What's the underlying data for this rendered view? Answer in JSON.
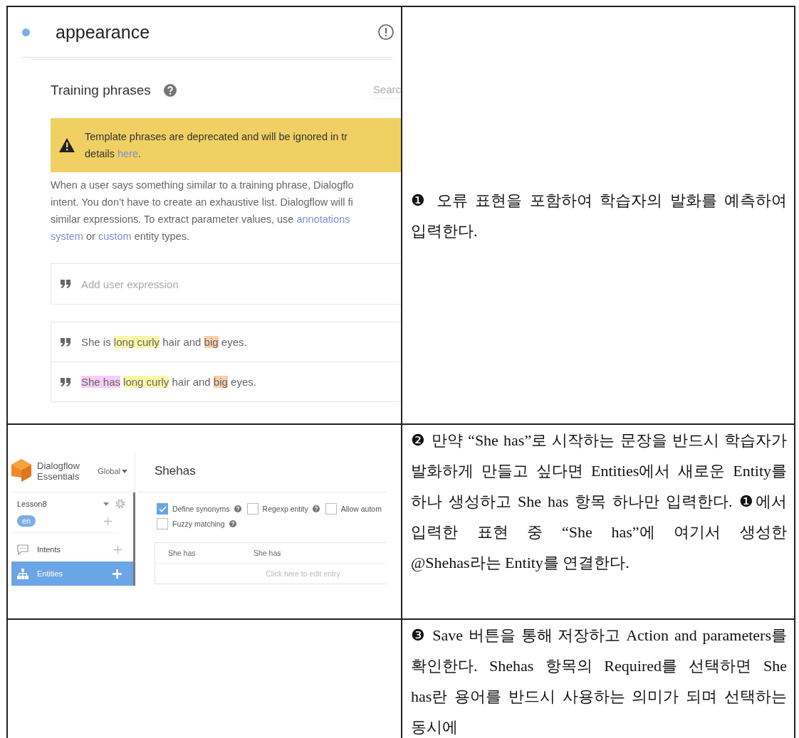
{
  "table": {
    "rows": [
      {
        "left": {
          "kind": "intent_training",
          "intent": {
            "title": "appearance"
          },
          "training": {
            "heading": "Training phrases",
            "search_placeholder": "Searc",
            "banner": [
              [
                {
                  "kind": "text",
                  "text": "Template phrases are deprecated and will be ignored in tr"
                }
              ],
              [
                {
                  "kind": "text",
                  "text": "details "
                },
                {
                  "kind": "link",
                  "text": "here"
                },
                {
                  "kind": "text",
                  "text": "."
                }
              ]
            ],
            "description": [
              [
                {
                  "kind": "text",
                  "text": "When a user says something similar to a training phrase, Dialogflo"
                }
              ],
              [
                {
                  "kind": "text",
                  "text": "intent. You don’t have to create an exhaustive list. Dialogflow will fi"
                }
              ],
              [
                {
                  "kind": "text",
                  "text": "similar expressions. To extract parameter values, use "
                },
                {
                  "kind": "link",
                  "text": "annotations"
                }
              ],
              [
                {
                  "kind": "link",
                  "text": "system"
                },
                {
                  "kind": "text",
                  "text": " or "
                },
                {
                  "kind": "link",
                  "text": "custom"
                },
                {
                  "kind": "text",
                  "text": " entity types."
                }
              ]
            ],
            "input_placeholder": "Add user expression",
            "phrases": [
              [
                {
                  "text": "She is "
                },
                {
                  "text": "long curly",
                  "color": "#fbf7a8"
                },
                {
                  "text": " hair and "
                },
                {
                  "text": "big",
                  "color": "#f8cfa8"
                },
                {
                  "text": " eyes."
                }
              ],
              [
                {
                  "text": "She has",
                  "color": "#f6cdf6"
                },
                {
                  "text": "long curly",
                  "color": "#fbf7a8"
                },
                {
                  "text": " hair and "
                },
                {
                  "text": "big",
                  "color": "#f8cfa8"
                },
                {
                  "text": " eyes."
                }
              ]
            ]
          }
        },
        "right": "❶ 오류 표현을 포함하여 학습자의 발화를 예측하여 입력한다."
      },
      {
        "left": {
          "kind": "entity_editor",
          "app": {
            "brand": [
              "Dialogflow",
              "Essentials"
            ],
            "region": "Global",
            "agent": "Lesson8",
            "language": "en",
            "nav": [
              {
                "label": "Intents",
                "selected": false
              },
              {
                "label": "Entities",
                "selected": true
              }
            ]
          },
          "entity": {
            "name": "Shehas",
            "options": [
              {
                "label": "Define synonyms",
                "checked": true,
                "help": true
              },
              {
                "label": "Regexp entity",
                "checked": false,
                "help": true
              },
              {
                "label": "Allow autom",
                "checked": false,
                "help": false
              },
              {
                "label": "Fuzzy matching",
                "checked": false,
                "help": true
              }
            ],
            "entries": [
              {
                "value": "She has",
                "synonyms": "She has"
              }
            ],
            "edit_hint": "Click here to edit entry"
          }
        },
        "right": "❷ 만약 “She has”로 시작하는 문장을 반드시 학습자가 발화하게 만들고 싶다면 Entities에서 새로운 Entity를 하나 생성하고 She has 항목 하나만 입력한다. ❶에서 입력한 표현 중 “She has”에 여기서 생성한 @Shehas라는 Entity를 연결한다."
      },
      {
        "left": {
          "kind": "blank"
        },
        "right": "❸ Save 버튼을 통해 저장하고 Action and parameters를 확인한다. Shehas 항목의 Required를 선택하면 She has란 용어를 반드시 사용하는 의미가 되며 선택하는 동시에"
      }
    ]
  }
}
